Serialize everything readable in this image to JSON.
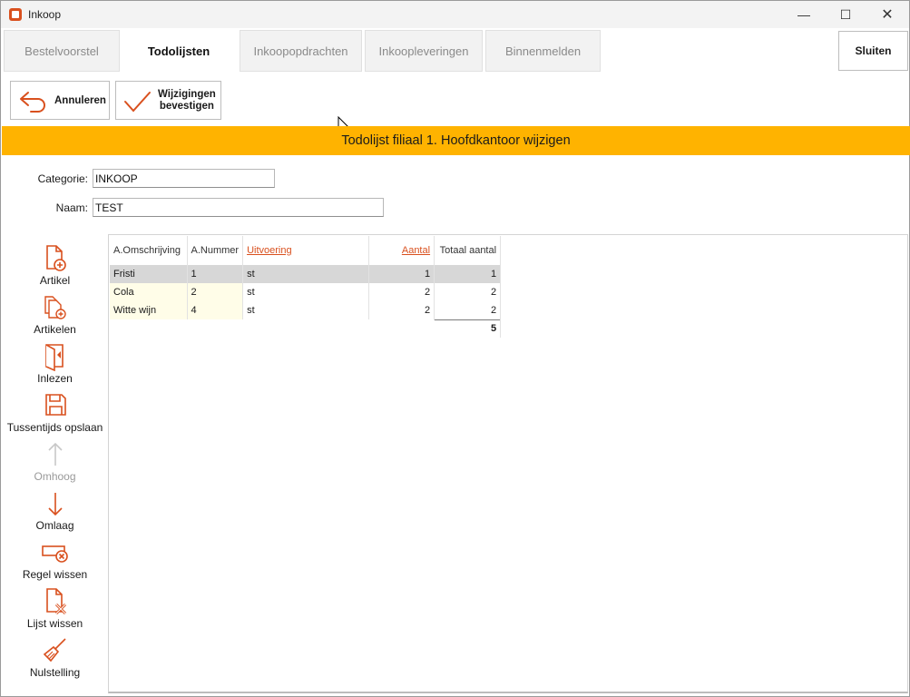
{
  "window": {
    "title": "Inkoop",
    "minimize": "—",
    "maximize": "☐",
    "close": "✕"
  },
  "tabs": [
    {
      "label": "Bestelvoorstel",
      "active": false
    },
    {
      "label": "Todolijsten",
      "active": true
    },
    {
      "label": "Inkoopopdrachten",
      "active": false
    },
    {
      "label": "Inkoopleveringen",
      "active": false
    },
    {
      "label": "Binnenmelden",
      "active": false
    }
  ],
  "close_button": "Sluiten",
  "actions": {
    "cancel": "Annuleren",
    "confirm": "Wijzigingen\nbevestigen"
  },
  "banner": "Todolijst filiaal 1. Hoofdkantoor wijzigen",
  "form": {
    "category_label": "Categorie:",
    "category_value": "INKOOP",
    "name_label": "Naam:",
    "name_value": "TEST"
  },
  "tools": [
    {
      "label": "Artikel",
      "icon": "file-plus-icon",
      "enabled": true
    },
    {
      "label": "Artikelen",
      "icon": "files-plus-icon",
      "enabled": true
    },
    {
      "label": "Inlezen",
      "icon": "import-icon",
      "enabled": true
    },
    {
      "label": "Tussentijds opslaan",
      "icon": "save-icon",
      "enabled": true
    },
    {
      "label": "Omhoog",
      "icon": "arrow-up-icon",
      "enabled": false
    },
    {
      "label": "Omlaag",
      "icon": "arrow-down-icon",
      "enabled": true
    },
    {
      "label": "Regel wissen",
      "icon": "row-delete-icon",
      "enabled": true
    },
    {
      "label": "Lijst wissen",
      "icon": "file-delete-icon",
      "enabled": true
    },
    {
      "label": "Nulstelling",
      "icon": "broom-icon",
      "enabled": true
    }
  ],
  "grid": {
    "columns": [
      "A.Omschrijving",
      "A.Nummer",
      "Uitvoering",
      "Aantal",
      "Totaal aantal"
    ],
    "rows": [
      {
        "omschrijving": "Fristi",
        "nummer": "1",
        "uitvoering": "st",
        "aantal": "1",
        "totaal": "1",
        "selected": true
      },
      {
        "omschrijving": "Cola",
        "nummer": "2",
        "uitvoering": "st",
        "aantal": "2",
        "totaal": "2",
        "selected": false
      },
      {
        "omschrijving": "Witte wijn",
        "nummer": "4",
        "uitvoering": "st",
        "aantal": "2",
        "totaal": "2",
        "selected": false
      }
    ],
    "sum_total": "5"
  },
  "colors": {
    "accent": "#d9501e",
    "banner": "#ffb300",
    "selected_row": "#d7d7d7",
    "highlight_cell": "#fffde8"
  }
}
